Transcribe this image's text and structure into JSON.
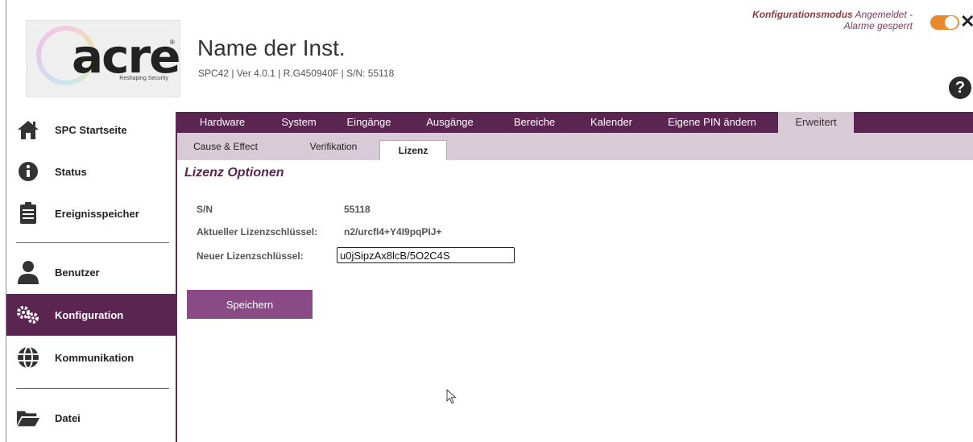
{
  "logo": {
    "text": "acre",
    "tagline": "Reshaping Security",
    "reg": "®"
  },
  "header": {
    "institution": "Name der Inst.",
    "info": "SPC42  |  Ver 4.0.1  |  R.G450940F  |  S/N: 55118",
    "mode_bold": "Konfigurationsmodus",
    "mode_rest": " Angemeldet -",
    "mode_line2": "Alarme gesperrt",
    "help": "?"
  },
  "sidebar": {
    "items": [
      {
        "label": "SPC Startseite",
        "icon": "home-icon"
      },
      {
        "label": "Status",
        "icon": "info-icon"
      },
      {
        "label": "Ereignisspeicher",
        "icon": "clipboard-icon"
      },
      {
        "label": "Benutzer",
        "icon": "user-icon"
      },
      {
        "label": "Konfiguration",
        "icon": "gears-icon",
        "active": true
      },
      {
        "label": "Kommunikation",
        "icon": "globe-icon"
      },
      {
        "label": "Datei",
        "icon": "folder-icon"
      }
    ]
  },
  "main_tabs": [
    "Hardware",
    "System",
    "Eingänge",
    "Ausgänge",
    "Bereiche",
    "Kalender",
    "Eigene PIN ändern",
    "Erweitert"
  ],
  "sub_tabs": [
    "Cause & Effect",
    "Verifikation",
    "Lizenz"
  ],
  "content": {
    "title": "Lizenz Optionen",
    "sn_label": "S/N",
    "sn_value": "55118",
    "current_key_label": "Aktueller Lizenzschlüssel:",
    "current_key_value": "n2/urcfI4+Y4I9pqPIJ+",
    "new_key_label": "Neuer Lizenzschlüssel:",
    "new_key_value": "u0jSipzAx8lcB/5O2C4S",
    "save_label": "Speichern"
  },
  "colors": {
    "brand": "#5a2550",
    "button": "#8a4a85",
    "toggle": "#e8892f",
    "subtab_bg": "#d9cbd5"
  }
}
